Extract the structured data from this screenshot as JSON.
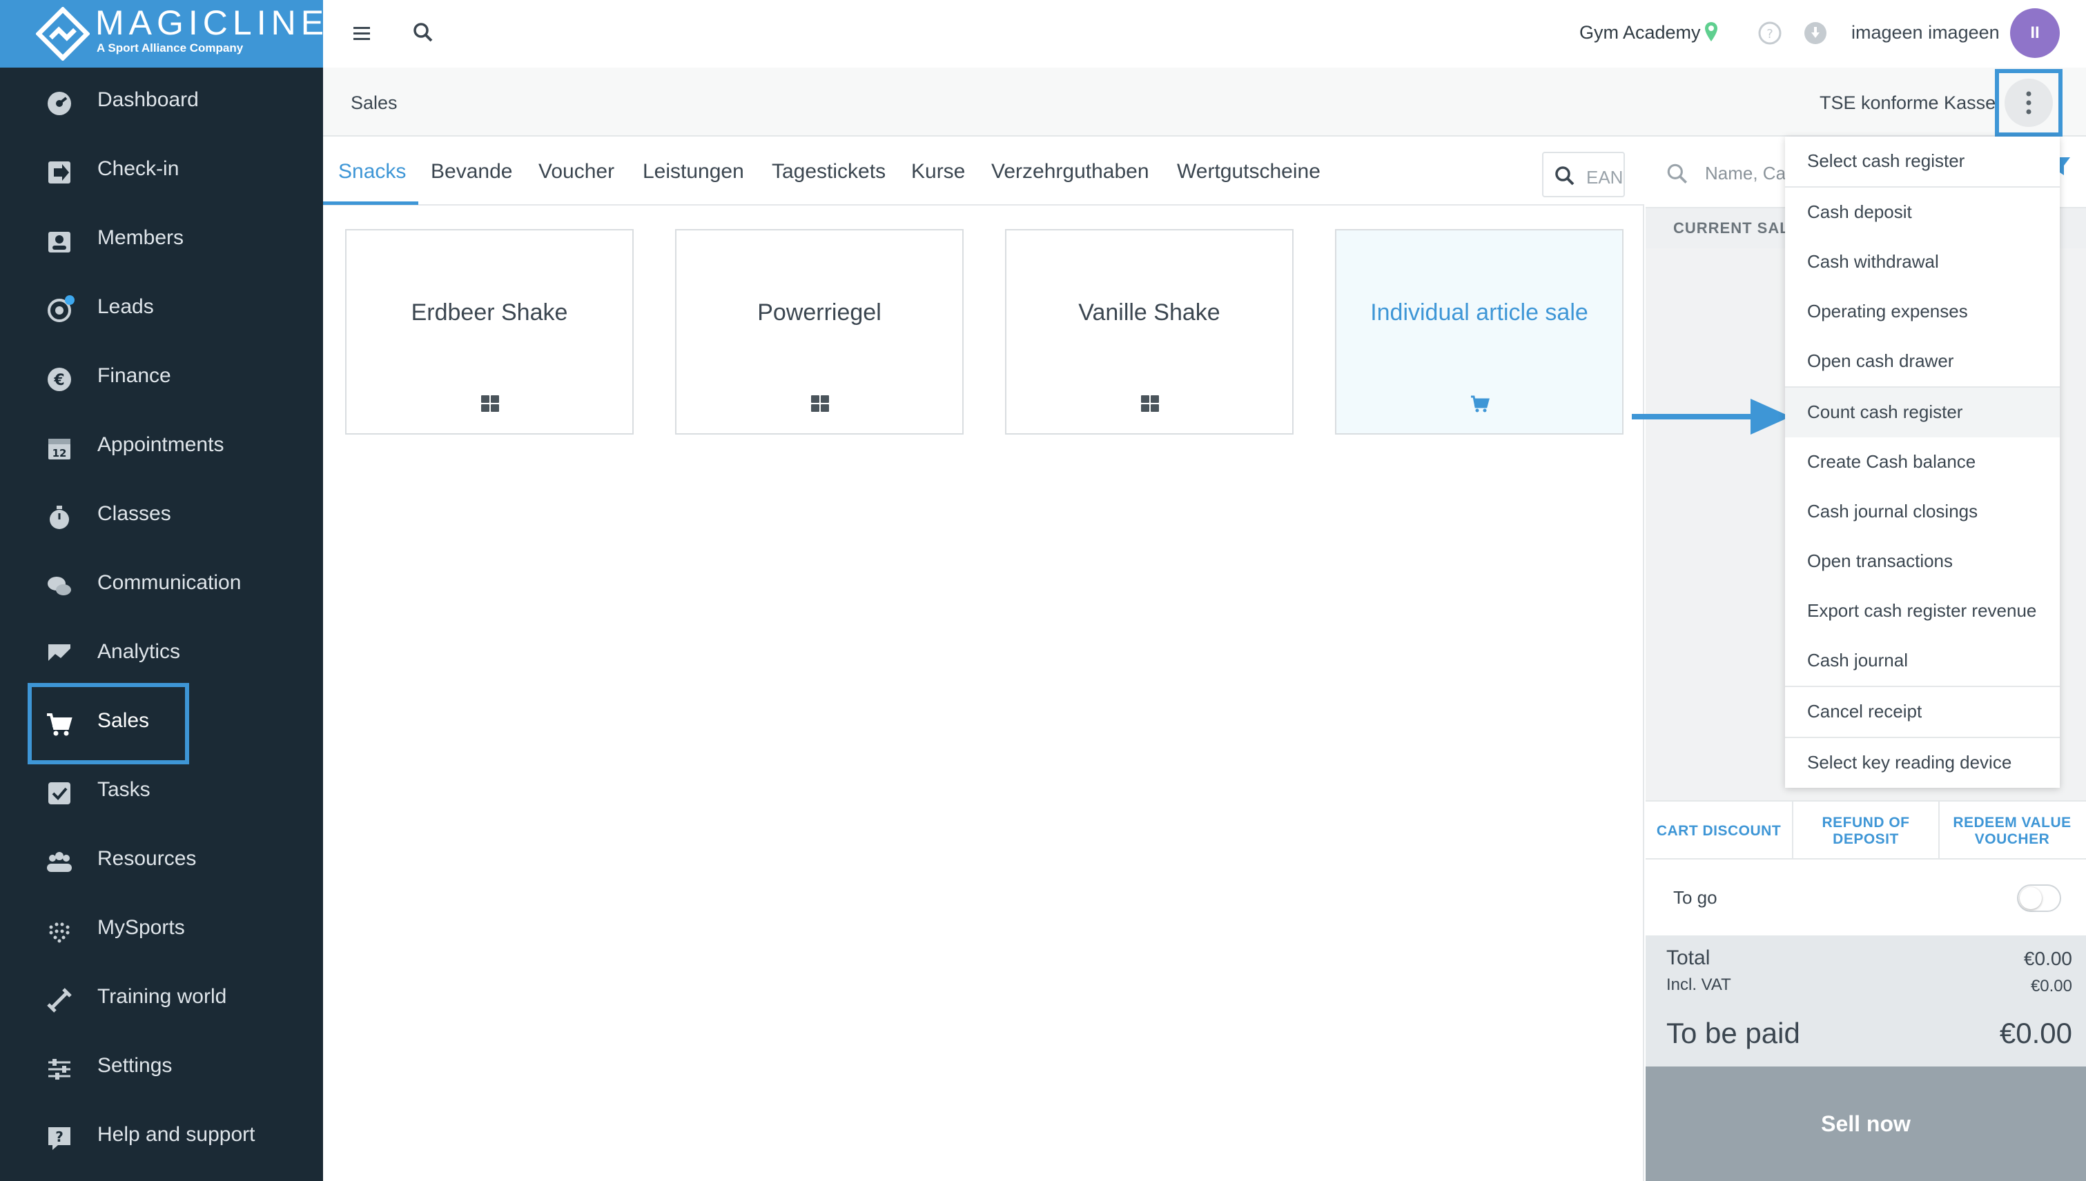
{
  "brand": {
    "title": "MAGICLINE",
    "subtitle": "A Sport Alliance Company",
    "color": "#3e96d6"
  },
  "sidebar": {
    "items": [
      {
        "label": "Dashboard",
        "icon": "dashboard-icon"
      },
      {
        "label": "Check-in",
        "icon": "checkin-icon"
      },
      {
        "label": "Members",
        "icon": "members-icon"
      },
      {
        "label": "Leads",
        "icon": "leads-icon"
      },
      {
        "label": "Finance",
        "icon": "euro-icon"
      },
      {
        "label": "Appointments",
        "icon": "calendar-icon"
      },
      {
        "label": "Classes",
        "icon": "stopwatch-icon"
      },
      {
        "label": "Communication",
        "icon": "chat-icon"
      },
      {
        "label": "Analytics",
        "icon": "chart-icon"
      },
      {
        "label": "Sales",
        "icon": "cart-icon"
      },
      {
        "label": "Tasks",
        "icon": "checkbox-icon"
      },
      {
        "label": "Resources",
        "icon": "group-icon"
      },
      {
        "label": "MySports",
        "icon": "mysports-icon"
      },
      {
        "label": "Training world",
        "icon": "dumbbell-icon"
      },
      {
        "label": "Settings",
        "icon": "sliders-icon"
      },
      {
        "label": "Help and support",
        "icon": "help-icon"
      }
    ],
    "active": "Sales"
  },
  "topbar": {
    "location": "Gym Academy",
    "user": "imageen imageen",
    "avatar_initials": "II"
  },
  "subbar": {
    "breadcrumb": "Sales",
    "register": "TSE konforme Kasse"
  },
  "tabs": [
    "Snacks",
    "Bevande",
    "Voucher",
    "Leistungen",
    "Tagestickets",
    "Kurse",
    "Verzehrguthaben",
    "Wertgutscheine"
  ],
  "ean_placeholder": "EAN",
  "products": [
    {
      "name": "Erdbeer Shake",
      "icon": "grid-icon"
    },
    {
      "name": "Powerriegel",
      "icon": "grid-icon"
    },
    {
      "name": "Vanille Shake",
      "icon": "grid-icon"
    },
    {
      "name": "Individual article sale",
      "icon": "cart-icon"
    }
  ],
  "cart": {
    "search_placeholder": "Name, Card",
    "current_sale_label": "CURRENT SALE",
    "actions": [
      "CART DISCOUNT",
      "REFUND OF DEPOSIT",
      "REDEEM VALUE VOUCHER"
    ],
    "to_go_label": "To go",
    "total_label": "Total",
    "total_value": "€0.00",
    "vat_label": "Incl. VAT",
    "vat_value": "€0.00",
    "to_pay_label": "To be paid",
    "to_pay_value": "€0.00",
    "sell_label": "Sell now"
  },
  "menu": {
    "items": [
      "Select cash register",
      "Cash deposit",
      "Cash withdrawal",
      "Operating expenses",
      "Open cash drawer",
      "Count cash register",
      "Create Cash balance",
      "Cash journal closings",
      "Open transactions",
      "Export cash register revenue",
      "Cash journal",
      "Cancel receipt",
      "Select key reading device"
    ],
    "highlighted": "Count cash register"
  }
}
